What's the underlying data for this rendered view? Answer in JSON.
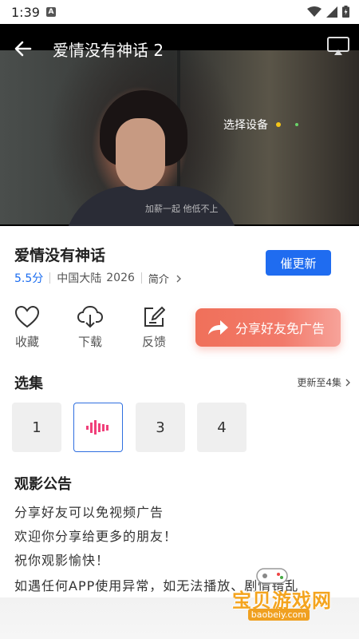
{
  "status_bar": {
    "time": "1:39",
    "notif_letter": "A"
  },
  "player": {
    "title": "爱情没有神话 2",
    "select_device": "选择设备",
    "subtitle": "加薪一起    他低不上"
  },
  "show": {
    "name": "爱情没有神话",
    "score": "5.5分",
    "region": "中国大陆",
    "year": "2026",
    "synopsis_label": "简介",
    "update_button": "催更新"
  },
  "actions": [
    {
      "label": "收藏",
      "icon": "heart-icon"
    },
    {
      "label": "下载",
      "icon": "cloud-download-icon"
    },
    {
      "label": "反馈",
      "icon": "edit-icon"
    }
  ],
  "share": {
    "label": "分享好友免广告"
  },
  "episodes": {
    "title": "选集",
    "update_info": "更新至4集",
    "items": [
      "1",
      "",
      "3",
      "4"
    ],
    "active_index": 1
  },
  "notice": {
    "title": "观影公告",
    "lines": [
      "分享好友可以免视频广告",
      "欢迎你分享给更多的朋友！",
      "祝你观影愉快！",
      "如遇任何APP使用异常，如无法播放、剧情错乱"
    ]
  },
  "watermark": {
    "text": "宝贝游戏网",
    "url": "baobeiy.com"
  },
  "colors": {
    "accent": "#1f6cf0",
    "share_gradient_start": "#f0705a",
    "watermark": "#f4a41e"
  }
}
